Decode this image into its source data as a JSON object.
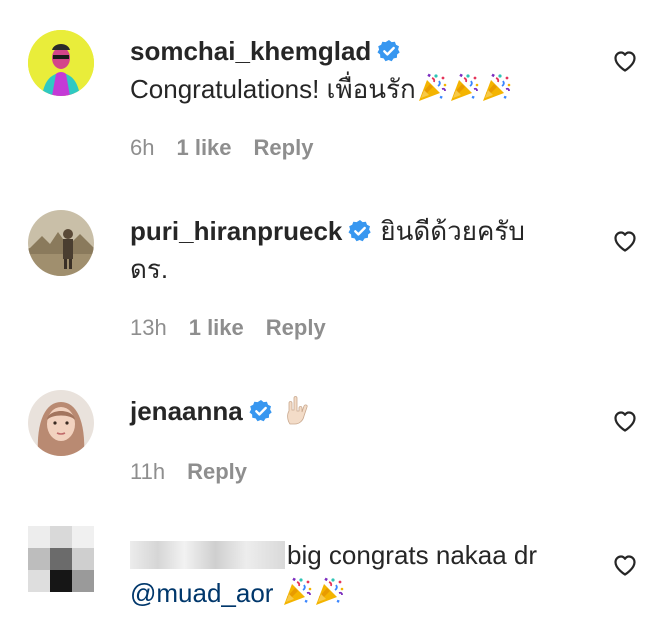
{
  "comments": [
    {
      "username": "somchai_khemglad",
      "verified": true,
      "text": "Congratulations! เพื่อนรัก",
      "emojis": [
        "party-popper",
        "party-popper",
        "party-popper"
      ],
      "time": "6h",
      "likes": "1 like",
      "reply": "Reply"
    },
    {
      "username": "puri_hiranprueck",
      "verified": true,
      "text": "ยินดีด้วยครับ ดร.",
      "time": "13h",
      "likes": "1 like",
      "reply": "Reply"
    },
    {
      "username": "jenaanna",
      "verified": true,
      "emojis": [
        "love-you-gesture"
      ],
      "time": "11h",
      "reply": "Reply"
    },
    {
      "username_redacted": true,
      "text": "big congrats nakaa dr",
      "mention": "@muad_aor",
      "emojis": [
        "party-popper",
        "party-popper"
      ]
    }
  ],
  "colors": {
    "verified_blue": "#3897f0",
    "meta_gray": "#8e8e8e",
    "mention_blue": "#00376b"
  }
}
